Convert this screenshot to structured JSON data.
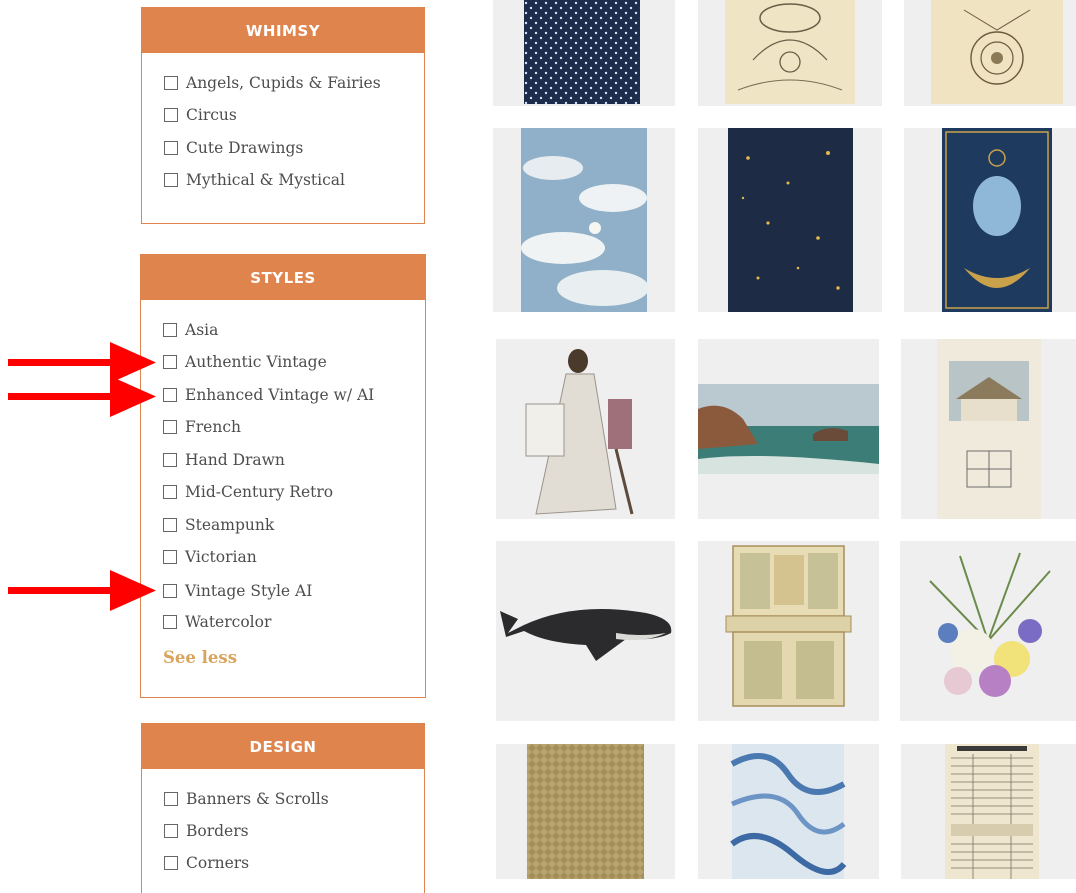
{
  "filters": {
    "whimsy": {
      "title": "WHIMSY",
      "options": [
        "Angels, Cupids & Fairies",
        "Circus",
        "Cute Drawings",
        "Mythical & Mystical"
      ]
    },
    "styles": {
      "title": "STYLES",
      "options": [
        "Asia",
        "Authentic Vintage",
        "Enhanced Vintage w/ AI",
        "French",
        "Hand Drawn",
        "Mid-Century Retro",
        "Steampunk",
        "Victorian",
        "Vintage Style AI",
        "Watercolor"
      ],
      "see_less": "See less"
    },
    "design": {
      "title": "DESIGN",
      "options": [
        "Banners & Scrolls",
        "Borders",
        "Corners"
      ]
    }
  },
  "annotations": {
    "arrow_color": "#ff0000",
    "highlighted_options": [
      "Authentic Vintage",
      "Enhanced Vintage w/ AI",
      "Vintage Style AI"
    ]
  },
  "gallery": {
    "tiles": [
      {
        "subject": "navy star pattern"
      },
      {
        "subject": "antique balloon engraving"
      },
      {
        "subject": "celestial diagram"
      },
      {
        "subject": "cloudy sky painting"
      },
      {
        "subject": "starry night sky"
      },
      {
        "subject": "celestial woman with moon"
      },
      {
        "subject": "regency woman seated"
      },
      {
        "subject": "coastal seascape"
      },
      {
        "subject": "cottage with floor plan"
      },
      {
        "subject": "humpback whale"
      },
      {
        "subject": "vintage secretary desk"
      },
      {
        "subject": "flower bouquet"
      },
      {
        "subject": "woven texture"
      },
      {
        "subject": "blue marbled paper"
      },
      {
        "subject": "tide table"
      }
    ]
  },
  "colors": {
    "accent": "#e0844d",
    "see_less": "#d9a45c",
    "tile_bg": "#efefef"
  }
}
